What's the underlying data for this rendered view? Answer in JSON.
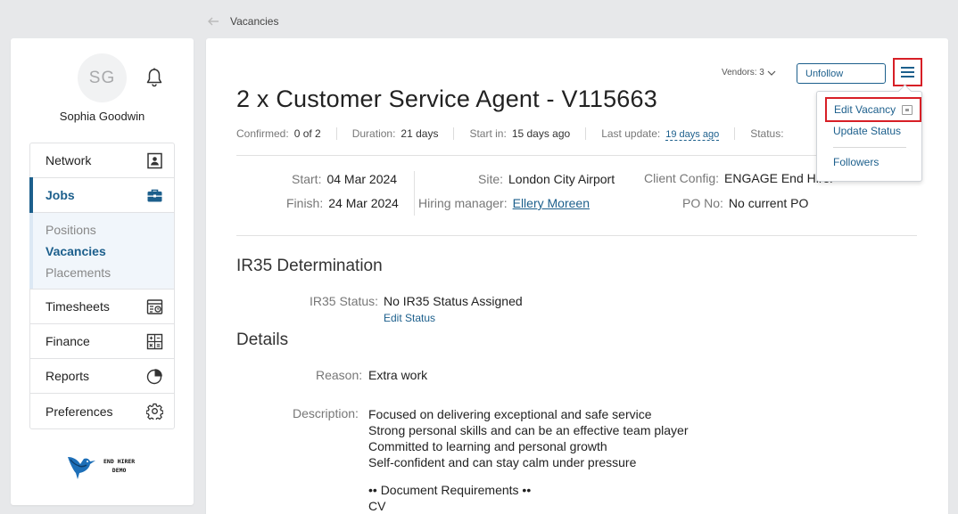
{
  "breadcrumb": {
    "back_icon": "arrow-left-icon",
    "label": "Vacancies"
  },
  "user": {
    "initials": "SG",
    "name": "Sophia Goodwin"
  },
  "sidebar": {
    "items": [
      {
        "label": "Network",
        "icon": "contact-card-icon"
      },
      {
        "label": "Jobs",
        "icon": "briefcase-icon"
      },
      {
        "label": "Timesheets",
        "icon": "timesheet-icon"
      },
      {
        "label": "Finance",
        "icon": "calculator-icon"
      },
      {
        "label": "Reports",
        "icon": "pie-chart-icon"
      },
      {
        "label": "Preferences",
        "icon": "gear-icon"
      }
    ],
    "jobs_sub": [
      "Positions",
      "Vacancies",
      "Placements"
    ],
    "logo_line1": "END HIRER",
    "logo_line2": "DEMO"
  },
  "header": {
    "title": "2 x Customer Service Agent - V115663",
    "vendors": "Vendors: 3",
    "unfollow": "Unfollow"
  },
  "meta": {
    "confirmed_label": "Confirmed:",
    "confirmed": "0 of 2",
    "duration_label": "Duration:",
    "duration": "21 days",
    "startin_label": "Start in:",
    "startin": "15 days ago",
    "lastupdate_label": "Last update:",
    "lastupdate": "19 days ago",
    "status_label": "Status:"
  },
  "info": {
    "start_label": "Start:",
    "start": "04 Mar 2024",
    "finish_label": "Finish:",
    "finish": "24 Mar 2024",
    "site_label": "Site:",
    "site": "London City Airport",
    "hm_label": "Hiring manager:",
    "hm": "Ellery Moreen",
    "client_label": "Client Config:",
    "client": "ENGAGE End Hirer",
    "po_label": "PO No:",
    "po": "No current PO"
  },
  "ir35": {
    "heading": "IR35 Determination",
    "status_label": "IR35 Status:",
    "status": "No IR35 Status Assigned",
    "edit": "Edit Status"
  },
  "details": {
    "heading": "Details",
    "reason_label": "Reason:",
    "reason": "Extra work",
    "description_label": "Description:",
    "description": [
      "Focused on delivering exceptional and safe service",
      "Strong personal skills and can be an effective team player",
      "Committed to learning and personal growth",
      "Self-confident and can stay calm under pressure"
    ],
    "doc_heading": "•• Document Requirements ••",
    "doc_first": "CV"
  },
  "dropdown": {
    "edit": "Edit Vacancy",
    "update": "Update Status",
    "followers": "Followers"
  },
  "colors": {
    "accent": "#1c5f8c",
    "highlight": "#d71f26",
    "bg": "#e7e8ea"
  }
}
